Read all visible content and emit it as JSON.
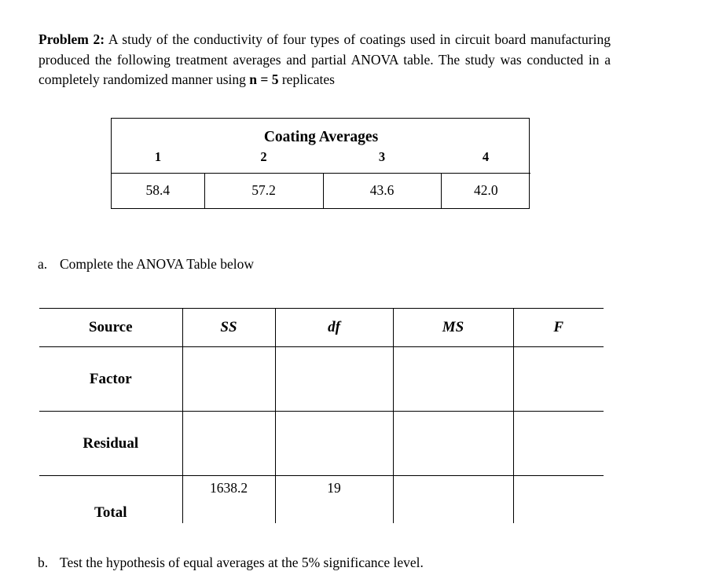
{
  "problem": {
    "label": "Problem 2:",
    "text_part1": " A study of the conductivity of four types of coatings used in circuit board manufacturing produced the following treatment averages and partial ANOVA table. The study was conducted in a completely randomized manner using ",
    "bold_n": "n = 5",
    "text_part2": " replicates"
  },
  "coating_table": {
    "title": "Coating Averages",
    "headers": [
      "1",
      "2",
      "3",
      "4"
    ],
    "values": [
      "58.4",
      "57.2",
      "43.6",
      "42.0"
    ]
  },
  "items": {
    "a": {
      "marker": "a.",
      "text": "Complete the ANOVA Table below"
    },
    "b": {
      "marker": "b.",
      "text": "Test the hypothesis of equal averages at the 5% significance level."
    }
  },
  "anova_table": {
    "headers": [
      "Source",
      "SS",
      "df",
      "MS",
      "F"
    ],
    "rows": [
      {
        "source": "Factor",
        "ss": "",
        "df": "",
        "ms": "",
        "f": ""
      },
      {
        "source": "Residual",
        "ss": "",
        "df": "",
        "ms": "",
        "f": ""
      },
      {
        "source": "Total",
        "ss": "1638.2",
        "df": "19",
        "ms": "",
        "f": ""
      }
    ]
  }
}
